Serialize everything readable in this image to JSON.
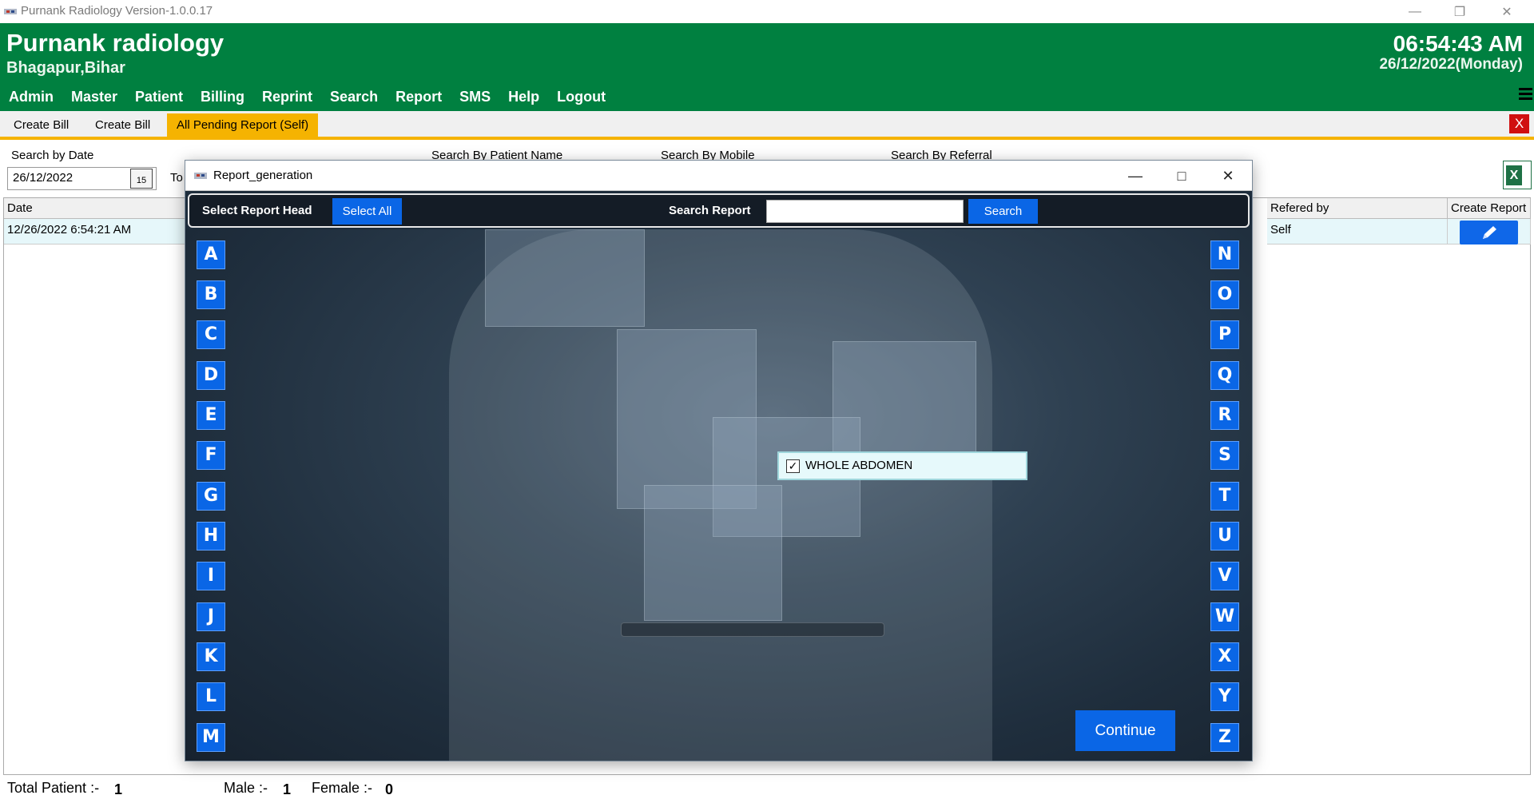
{
  "window": {
    "title": "Purnank Radiology Version-1.0.0.17"
  },
  "header": {
    "app_name": "Purnank radiology",
    "location": "Bhagapur,Bihar",
    "time": "06:54:43 AM",
    "date": "26/12/2022(Monday)",
    "menu": [
      "Admin",
      "Master",
      "Patient",
      "Billing",
      "Reprint",
      "Search",
      "Report",
      "SMS",
      "Help",
      "Logout"
    ]
  },
  "tabs": [
    {
      "label": "Create Bill",
      "active": false
    },
    {
      "label": "Create Bill",
      "active": false
    },
    {
      "label": "All Pending Report (Self)",
      "active": true
    }
  ],
  "tab_close_label": "X",
  "filters": {
    "search_by_date_label": "Search by Date",
    "date_value": "26/12/2022",
    "calendar_day": "15",
    "to_label": "To",
    "patient_name_label": "Search By Patient Name",
    "mobile_label": "Search By Mobile",
    "referral_label": "Search By Referral"
  },
  "table": {
    "headers": {
      "date": "Date",
      "refered_by": "Refered by",
      "create_report": "Create Report"
    },
    "rows": [
      {
        "date": "12/26/2022 6:54:21 AM",
        "refered_by": "Self"
      }
    ]
  },
  "footer": {
    "total_label": "Total Patient :-",
    "total_value": "1",
    "male_label": "Male :-",
    "male_value": "1",
    "female_label": "Female :-",
    "female_value": "0"
  },
  "modal": {
    "title": "Report_generation",
    "select_head_label": "Select Report Head",
    "select_all_label": "Select All",
    "search_report_label": "Search Report",
    "search_value": "",
    "search_button": "Search",
    "letters_left": [
      "A",
      "B",
      "C",
      "D",
      "E",
      "F",
      "G",
      "H",
      "I",
      "J",
      "K",
      "L",
      "M"
    ],
    "letters_right": [
      "N",
      "O",
      "P",
      "Q",
      "R",
      "S",
      "T",
      "U",
      "V",
      "W",
      "X",
      "Y",
      "Z"
    ],
    "report_items": [
      {
        "label": "WHOLE ABDOMEN",
        "checked": true
      }
    ],
    "continue_label": "Continue"
  },
  "colors": {
    "header_green": "#008040",
    "accent_yellow": "#f5b301",
    "button_blue": "#0a66e6",
    "close_red": "#d01010"
  }
}
